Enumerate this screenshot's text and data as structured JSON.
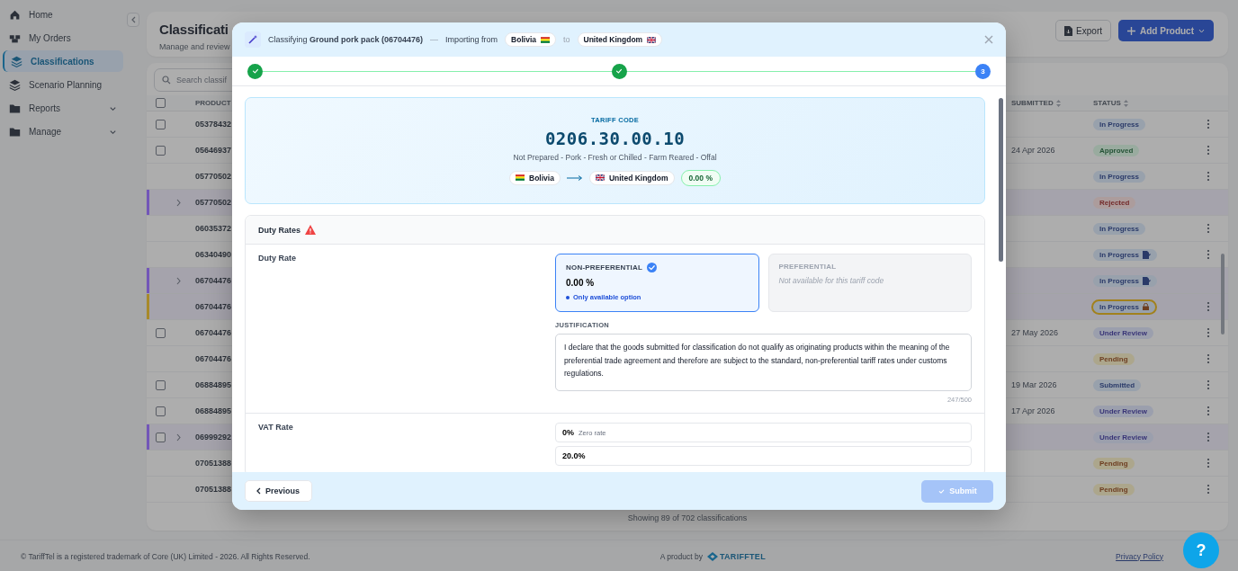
{
  "sidebar": {
    "items": [
      {
        "label": "Home",
        "selected": false
      },
      {
        "label": "My Orders",
        "selected": false
      },
      {
        "label": "Classifications",
        "selected": true
      },
      {
        "label": "Scenario Planning",
        "selected": false
      },
      {
        "label": "Reports",
        "selected": false,
        "expanded": false
      },
      {
        "label": "Manage",
        "selected": false,
        "expanded": false
      }
    ]
  },
  "header": {
    "title": "Classificati",
    "subtitle": "Manage and review",
    "export": "Export",
    "add": "Add Product"
  },
  "table": {
    "search_placeholder": "Search classif",
    "select_all": {
      "checked": false
    },
    "columns": [
      "PRODUCT",
      "SUBMITTED",
      "STATUS"
    ],
    "rows": [
      {
        "product": "05378432",
        "checked": false,
        "status": {
          "label": "In Progress",
          "kind": "progress",
          "draft": false,
          "locked": false
        },
        "menu": true
      },
      {
        "product": "05646937",
        "checked": false,
        "submitted": "24 Apr 2026",
        "status": {
          "label": "Approved",
          "kind": "approved",
          "draft": false,
          "locked": false
        },
        "menu": true
      },
      {
        "product": "05770502",
        "status": {
          "label": "In Progress",
          "kind": "progress",
          "draft": false,
          "locked": false
        },
        "menu": true
      },
      {
        "product": "05770502",
        "expanded": false,
        "color": "#7256b8",
        "status": {
          "label": "Rejected",
          "kind": "rejected",
          "draft": false,
          "locked": false
        },
        "menu": false
      },
      {
        "product": "06035372",
        "status": {
          "label": "In Progress",
          "kind": "progress",
          "draft": false,
          "locked": false
        },
        "menu": true
      },
      {
        "product": "06340490",
        "status": {
          "label": "In Progress",
          "kind": "progress",
          "draft": true,
          "locked": false
        },
        "menu": true
      },
      {
        "product": "06704476",
        "expanded": false,
        "color": "#7256b8",
        "status": {
          "label": "In Progress",
          "kind": "progress",
          "draft": true,
          "locked": false
        },
        "menu": false
      },
      {
        "product": "06704476",
        "color": "#a88a2a",
        "status": {
          "label": "In Progress",
          "kind": "progress",
          "draft": false,
          "locked": true
        },
        "menu": true
      },
      {
        "product": "06704476",
        "checked": false,
        "submitted": "27 May 2026",
        "status": {
          "label": "Under Review",
          "kind": "review",
          "draft": false,
          "locked": false
        },
        "menu": true
      },
      {
        "product": "06704476",
        "status": {
          "label": "Pending",
          "kind": "pending",
          "draft": false,
          "locked": false
        },
        "menu": true
      },
      {
        "product": "06884895",
        "checked": false,
        "submitted": "19 Mar 2026",
        "status": {
          "label": "Submitted",
          "kind": "submitted",
          "draft": false,
          "locked": false
        },
        "menu": true
      },
      {
        "product": "06884895",
        "checked": false,
        "submitted": "17 Apr 2026",
        "status": {
          "label": "Under Review",
          "kind": "review",
          "draft": false,
          "locked": false
        },
        "menu": true
      },
      {
        "product": "06999292",
        "checked": false,
        "expanded": false,
        "color": "#7256b8",
        "status": {
          "label": "Under Review",
          "kind": "review",
          "draft": false,
          "locked": false
        },
        "menu": true
      },
      {
        "product": "07051388",
        "status": {
          "label": "Pending",
          "kind": "pending",
          "draft": false,
          "locked": false
        },
        "menu": true
      },
      {
        "product": "07051388",
        "status": {
          "label": "Pending",
          "kind": "pending",
          "draft": false,
          "locked": false
        },
        "menu": true
      }
    ],
    "summary": "Showing 89 of 702 classifications"
  },
  "modal": {
    "heading": "Classifying **Ground pork pack (06704476)**",
    "separator": "—",
    "importing": "Importing from",
    "origin": "Bolivia",
    "to": "to",
    "destination": "United Kingdom",
    "steps": [
      {
        "kind": "done"
      },
      {
        "kind": "done"
      },
      {
        "kind": "current",
        "label": "3"
      }
    ],
    "tariff": {
      "label": "TARIFF CODE",
      "code": "0206.30.00.10",
      "description": "Not Prepared - Pork - Fresh or Chilled - Farm Reared - Offal",
      "origin": "Bolivia",
      "destination": "United Kingdom",
      "rate": "0.00 %"
    },
    "duty": {
      "title": "Duty Rates",
      "warning": true,
      "row_label": "Duty Rate",
      "options": [
        {
          "title": "NON-PREFERENTIAL",
          "value": "0.00 %",
          "note": "Only available option",
          "selected": true,
          "disabled": false
        },
        {
          "title": "PREFERENTIAL",
          "note": "Not available for this tariff code",
          "selected": false,
          "disabled": true
        }
      ],
      "justification_label": "JUSTIFICATION",
      "justification": "I declare that the goods submitted for classification do not qualify as originating products within the meaning of the preferential trade agreement and therefore are subject to the standard, non-preferential tariff rates under customs regulations.",
      "counter": "247/500"
    },
    "vat": {
      "label": "VAT Rate",
      "options": [
        {
          "value": "0%",
          "note": "Zero rate"
        },
        {
          "value": "20.0%"
        }
      ]
    },
    "previous": "Previous",
    "submit": {
      "label": "Submit",
      "disabled": true
    }
  },
  "footer": {
    "copyright": "© TariffTel is a registered trademark of Core (UK) Limited - 2026. All Rights Reserved.",
    "product_by": "A product by",
    "logo": "TARIFFTEL",
    "privacy": "Privacy Policy",
    "help": "?"
  }
}
